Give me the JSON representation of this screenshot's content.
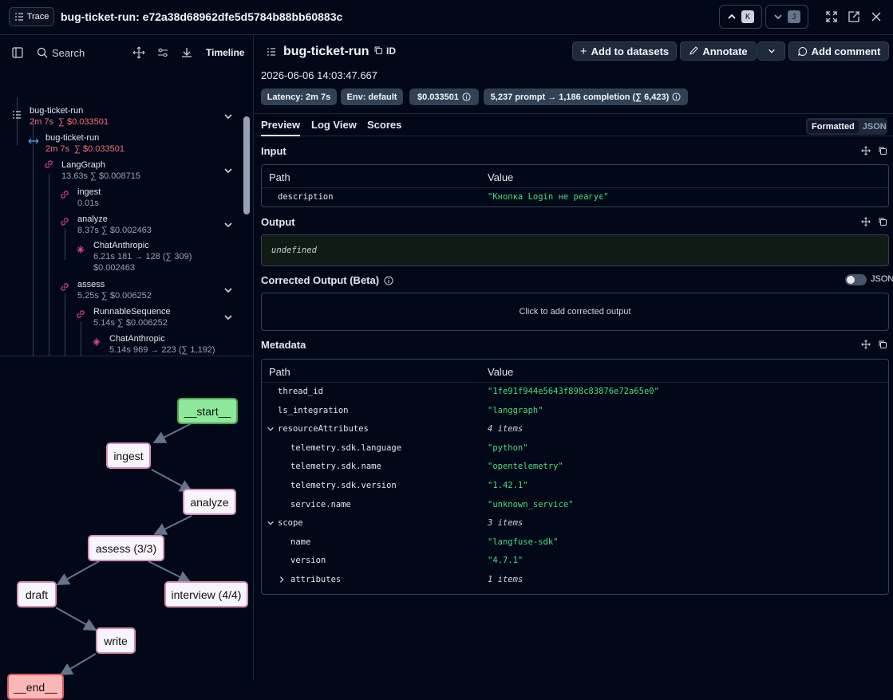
{
  "header": {
    "trace_label": "Trace",
    "title": "bug-ticket-run: e72a38d68962dfe5d5784b88bb60883c",
    "prev_key": "K",
    "next_key": "J"
  },
  "left_toolbar": {
    "search_placeholder": "Search",
    "timeline_label": "Timeline"
  },
  "tree": [
    {
      "name": "bug-ticket-run",
      "meta": "2m 7s",
      "cost": "∑ $0.033501"
    },
    {
      "name": "bug-ticket-run",
      "meta": "2m 7s",
      "cost": "∑ $0.033501"
    },
    {
      "name": "LangGraph",
      "meta": "13.63s  ∑ $0.008715"
    },
    {
      "name": "ingest",
      "meta": "0.01s"
    },
    {
      "name": "analyze",
      "meta": "8.37s  ∑ $0.002463"
    },
    {
      "name": "ChatAnthropic",
      "meta": "6.21s  181 → 128 (∑ 309)",
      "meta2": "$0.002463"
    },
    {
      "name": "assess",
      "meta": "5.25s  ∑ $0.006252"
    },
    {
      "name": "RunnableSequence",
      "meta": "5.14s  ∑ $0.006252"
    },
    {
      "name": "ChatAnthropic",
      "meta": "5.14s  969 → 223 (∑ 1,192)"
    }
  ],
  "graph": {
    "start": "__start__",
    "ingest": "ingest",
    "analyze": "analyze",
    "assess": "assess (3/3)",
    "draft": "draft",
    "interview": "interview (4/4)",
    "write": "write",
    "end": "__end__"
  },
  "detail": {
    "title": "bug-ticket-run",
    "id_label": "ID",
    "add_to_datasets": "Add to datasets",
    "annotate": "Annotate",
    "add_comment": "Add comment",
    "timestamp": "2026-06-06 14:03:47.667",
    "badges": {
      "latency": "Latency: 2m 7s",
      "env": "Env: default",
      "cost": "$0.033501",
      "tokens": "5,237 prompt → 1,186 completion (∑ 6,423)"
    },
    "tabs": [
      "Preview",
      "Log View",
      "Scores"
    ],
    "format_on": "Formatted",
    "format_off": "JSON",
    "input_label": "Input",
    "output_label": "Output",
    "output_value": "undefined",
    "corrected_label": "Corrected Output (Beta)",
    "corrected_toggle_label": "JSON",
    "corrected_placeholder": "Click to add corrected output",
    "metadata_label": "Metadata",
    "path_header": "Path",
    "value_header": "Value",
    "input_rows": [
      {
        "path": "description",
        "value": "\"Кнопка Login не реагує\""
      }
    ],
    "metadata_rows": [
      {
        "path": "thread_id",
        "value": "\"1fe91f944e5643f898c83876e72a65e0\""
      },
      {
        "path": "ls_integration",
        "value": "\"langgraph\""
      },
      {
        "path": "resourceAttributes",
        "value": "4 items"
      },
      {
        "path": "telemetry.sdk.language",
        "value": "\"python\""
      },
      {
        "path": "telemetry.sdk.name",
        "value": "\"opentelemetry\""
      },
      {
        "path": "telemetry.sdk.version",
        "value": "\"1.42.1\""
      },
      {
        "path": "service.name",
        "value": "\"unknown_service\""
      },
      {
        "path": "scope",
        "value": "3 items"
      },
      {
        "path": "name",
        "value": "\"langfuse-sdk\""
      },
      {
        "path": "version",
        "value": "\"4.7.1\""
      },
      {
        "path": "attributes",
        "value": "1 items"
      }
    ]
  }
}
